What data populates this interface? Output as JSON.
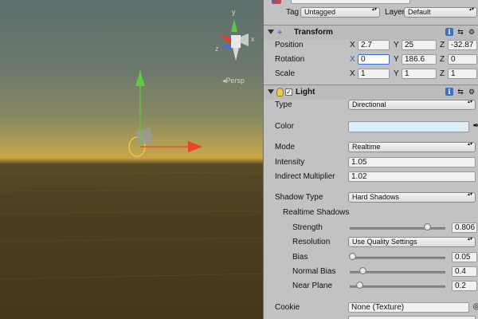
{
  "top": {
    "tag_label": "Tag",
    "tag_value": "Untagged",
    "layer_label": "Layer",
    "layer_value": "Default"
  },
  "scene": {
    "persp_label": "◂Persp",
    "gizmo_x": "x",
    "gizmo_y": "y",
    "gizmo_z": "z"
  },
  "transform": {
    "title": "Transform",
    "position_label": "Position",
    "rotation_label": "Rotation",
    "scale_label": "Scale",
    "position": {
      "x": "2.7",
      "y": "25",
      "z": "-32.87"
    },
    "rotation": {
      "x": "0",
      "y": "186.6",
      "z": "0"
    },
    "scale": {
      "x": "1",
      "y": "1",
      "z": "1"
    },
    "axis_x": "X",
    "axis_y": "Y",
    "axis_z": "Z"
  },
  "light": {
    "title": "Light",
    "type_label": "Type",
    "type_value": "Directional",
    "color_label": "Color",
    "color_value": "#dceefa",
    "mode_label": "Mode",
    "mode_value": "Realtime",
    "intensity_label": "Intensity",
    "intensity_value": "1.05",
    "indirect_label": "Indirect Multiplier",
    "indirect_value": "1.02",
    "shadow_type_label": "Shadow Type",
    "shadow_type_value": "Hard Shadows",
    "realtime_shadows_label": "Realtime Shadows",
    "strength_label": "Strength",
    "strength_value": "0.806",
    "resolution_label": "Resolution",
    "resolution_value": "Use Quality Settings",
    "bias_label": "Bias",
    "bias_value": "0.05",
    "normal_bias_label": "Normal Bias",
    "normal_bias_value": "0.4",
    "near_plane_label": "Near Plane",
    "near_plane_value": "0.2",
    "cookie_label": "Cookie",
    "cookie_value": "None (Texture)"
  },
  "sliders": {
    "strength": 0.806,
    "bias": 0.025,
    "normal_bias": 0.133,
    "near_plane": 0.1
  },
  "colors": {
    "accent": "#3a6fd6",
    "axis_x": "#e8452a",
    "axis_y": "#5ec93c",
    "inspector_bg": "#c2c2c2"
  }
}
